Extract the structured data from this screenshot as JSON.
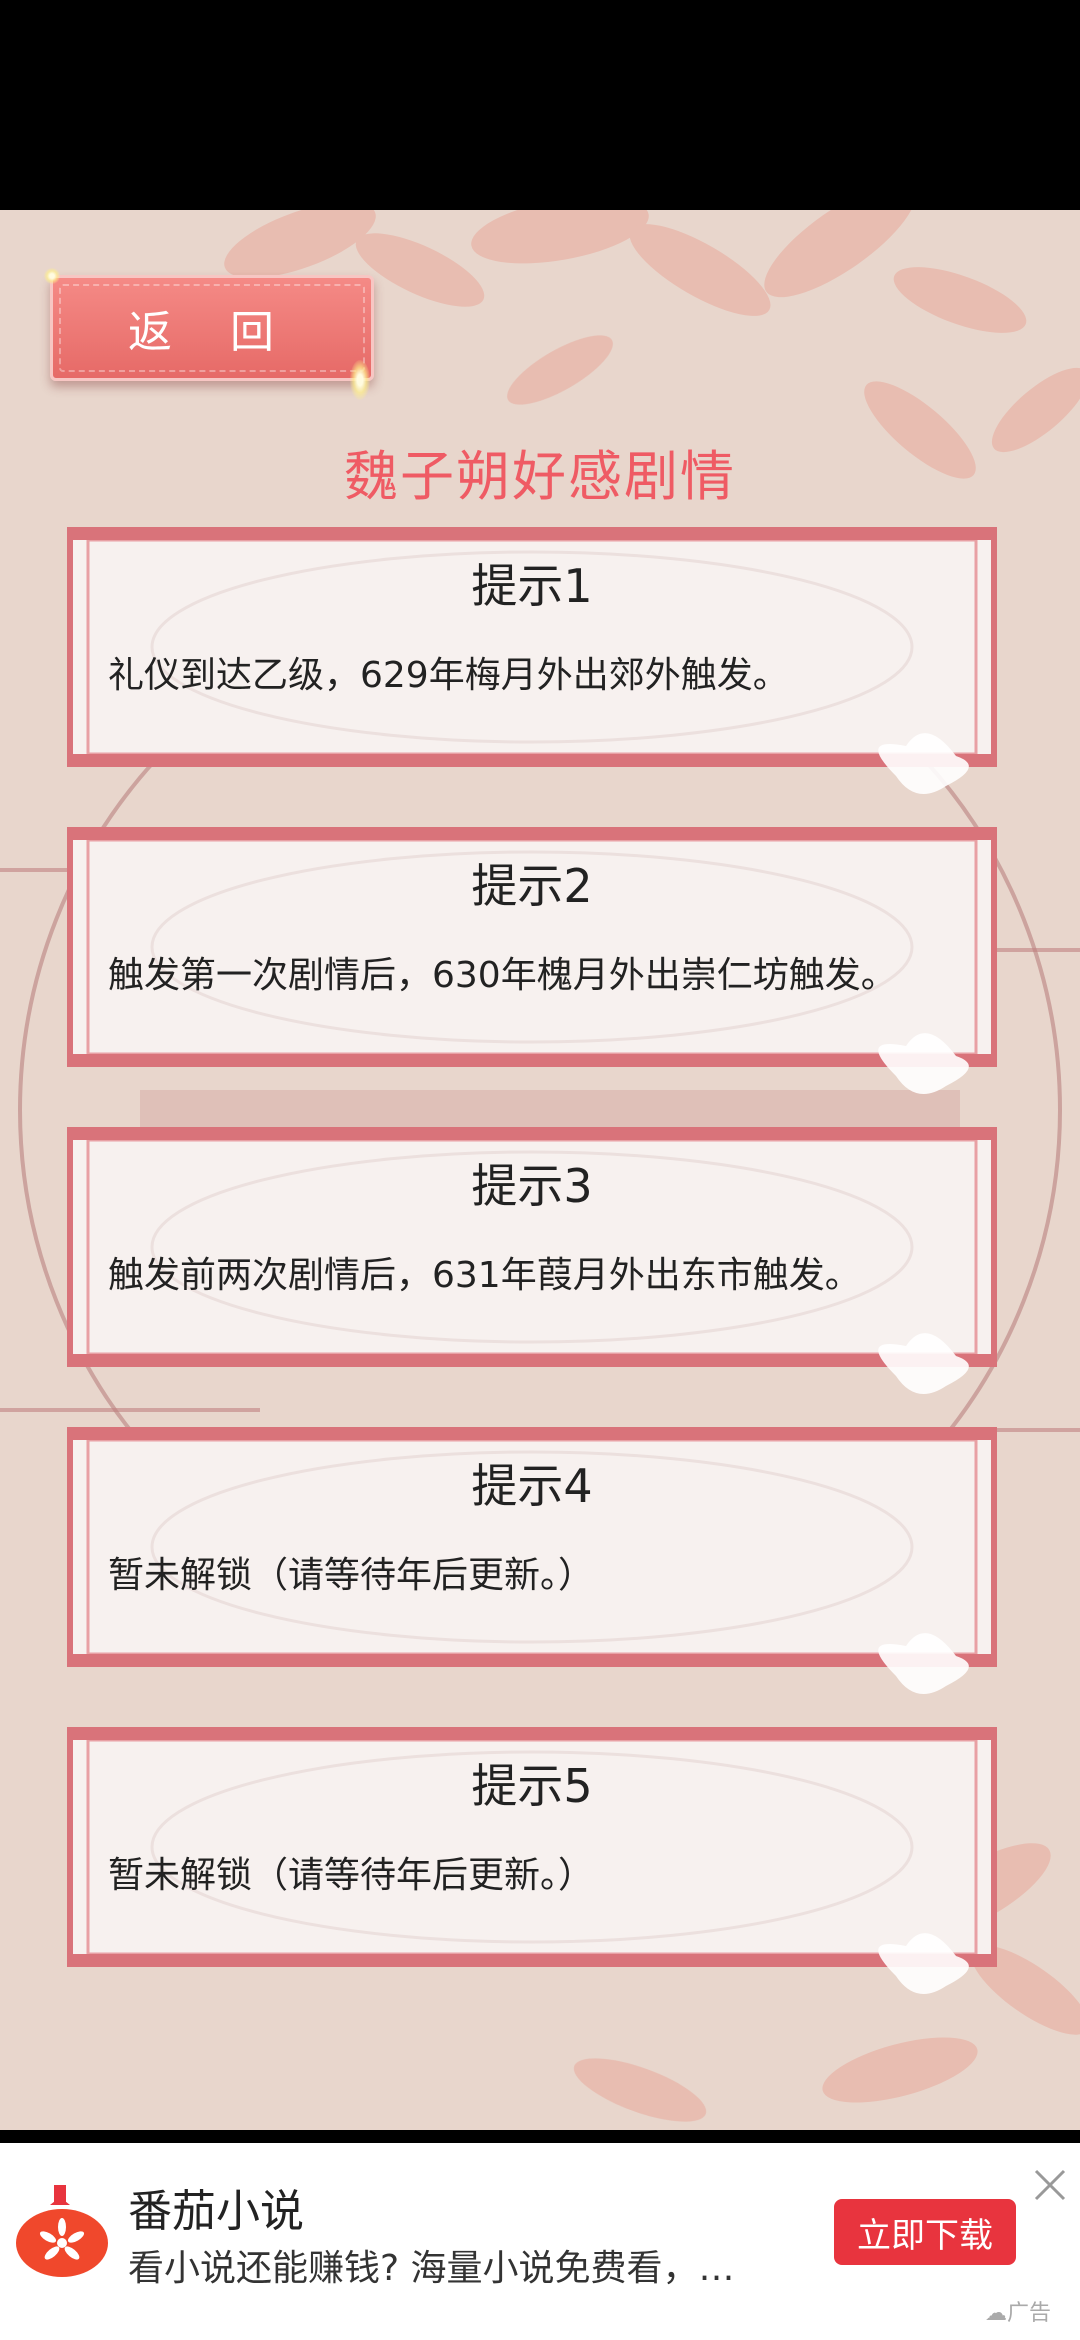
{
  "header": {
    "back_label": "返 回",
    "title": "魏子朔好感剧情"
  },
  "hints": [
    {
      "title": "提示1",
      "text": "礼仪到达乙级，629年梅月外出郊外触发。"
    },
    {
      "title": "提示2",
      "text": "触发第一次剧情后，630年槐月外出崇仁坊触发。"
    },
    {
      "title": "提示3",
      "text": "触发前两次剧情后，631年葭月外出东市触发。"
    },
    {
      "title": "提示4",
      "text": "暂未解锁（请等待年后更新。）"
    },
    {
      "title": "提示5",
      "text": "暂未解锁（请等待年后更新。）"
    }
  ],
  "ad": {
    "app_name": "番茄小说",
    "description": "看小说还能赚钱? 海量小说免费看，…",
    "download_label": "立即下载",
    "ad_tag": "广告",
    "logo_icon": "tomato-book-icon",
    "close_icon": "close-icon"
  },
  "colors": {
    "title": "#ef5b64",
    "frame": "#d9737a",
    "button": "#e66a67",
    "ad_button": "#e8343e"
  }
}
